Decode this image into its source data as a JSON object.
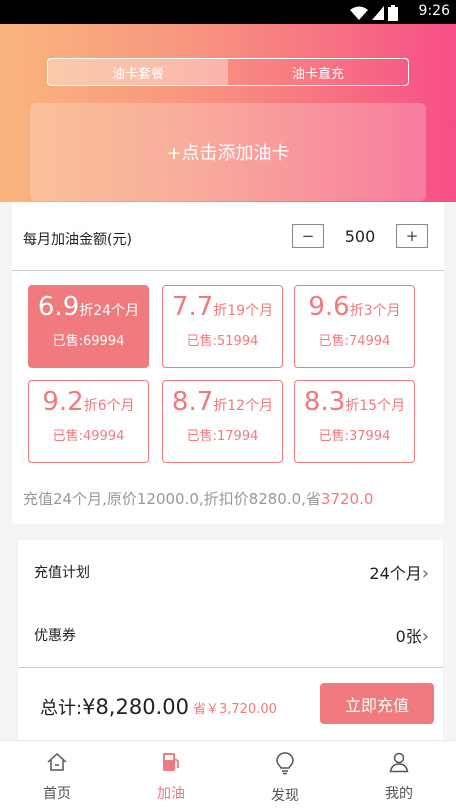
{
  "status_bar": {
    "time": "9:26"
  },
  "header": {
    "segments": [
      "油卡套餐",
      "油卡直充"
    ],
    "add_card_label": "+点击添加油卡"
  },
  "amount": {
    "label": "每月加油金额(元)",
    "value": "500",
    "minus_label": "−",
    "plus_label": "+"
  },
  "plans": [
    {
      "discount": "6.9",
      "suffix": "折24个月",
      "sold": "已售:69994"
    },
    {
      "discount": "7.7",
      "suffix": "折19个月",
      "sold": "已售:51994"
    },
    {
      "discount": "9.6",
      "suffix": "折3个月",
      "sold": "已售:74994"
    },
    {
      "discount": "9.2",
      "suffix": "折6个月",
      "sold": "已售:49994"
    },
    {
      "discount": "8.7",
      "suffix": "折12个月",
      "sold": "已售:17994"
    },
    {
      "discount": "8.3",
      "suffix": "折15个月",
      "sold": "已售:37994"
    }
  ],
  "summary": {
    "text": "充值24个月,原价12000.0,折扣价8280.0,省",
    "saved": "3720.0"
  },
  "order": {
    "plan_label": "充值计划",
    "plan_value": "24个月",
    "coupon_label": "优惠券",
    "coupon_value": "0张",
    "total_prefix": "总计:",
    "total_amount": "¥8,280.00",
    "saved_text": "省￥3,720.00",
    "pay_button": "立即充值"
  },
  "tabs": [
    {
      "label": "首页",
      "icon": "home-icon"
    },
    {
      "label": "加油",
      "icon": "fuel-icon"
    },
    {
      "label": "发现",
      "icon": "lightbulb-icon"
    },
    {
      "label": "我的",
      "icon": "user-icon"
    }
  ],
  "colors": {
    "accent": "#f17a7e",
    "gradient_start": "#f9b57d",
    "gradient_end": "#f64e87"
  }
}
